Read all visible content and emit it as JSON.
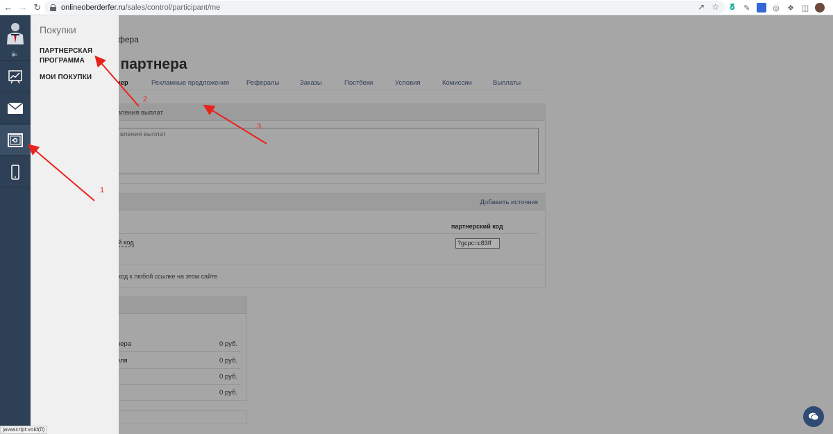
{
  "browser": {
    "url_host": "onlineoberderfer.ru",
    "url_path": "/sales/control/participant/me"
  },
  "status_bar": "javascript:void(0)",
  "flyout": {
    "title": "Покупки",
    "items": [
      {
        "label_line1": "ПАРТНЕРСКАЯ",
        "label_line2": "ПРОГРАММА"
      },
      {
        "label": "МОИ ПОКУПКИ"
      }
    ]
  },
  "page": {
    "subtitle": "фера",
    "title": "ет партнера",
    "tabs": [
      {
        "label": "нер",
        "active": true
      },
      {
        "label": "Рекламные предложения"
      },
      {
        "label": "Рефералы"
      },
      {
        "label": "Заказы"
      },
      {
        "label": "Постбеки"
      },
      {
        "label": "Условия"
      },
      {
        "label": "Комиссии"
      },
      {
        "label": "Выплаты"
      }
    ],
    "payout_panel": {
      "header": "вления выплат",
      "textarea_placeholder": "вления выплат"
    },
    "sources_panel": {
      "add_link": "Добавить источник",
      "col_header": "партнерский код",
      "row_label": "й код",
      "code_value": "?gcpc=c83ff",
      "hint": "код к любой ссылке на этом сайте"
    },
    "balance_panel": {
      "rows": [
        {
          "label": "нера",
          "value": "0 руб."
        },
        {
          "label": "еля",
          "value": "0 руб."
        },
        {
          "label": "",
          "value": "0 руб."
        },
        {
          "label": "",
          "value": "0 руб."
        }
      ]
    }
  },
  "annotations": {
    "arrow1": "1",
    "arrow2": "2",
    "arrow3": "3"
  },
  "colors": {
    "sidebar": "#2e4055",
    "arrow": "#e8231b",
    "overlay": "#a6a6a6"
  }
}
